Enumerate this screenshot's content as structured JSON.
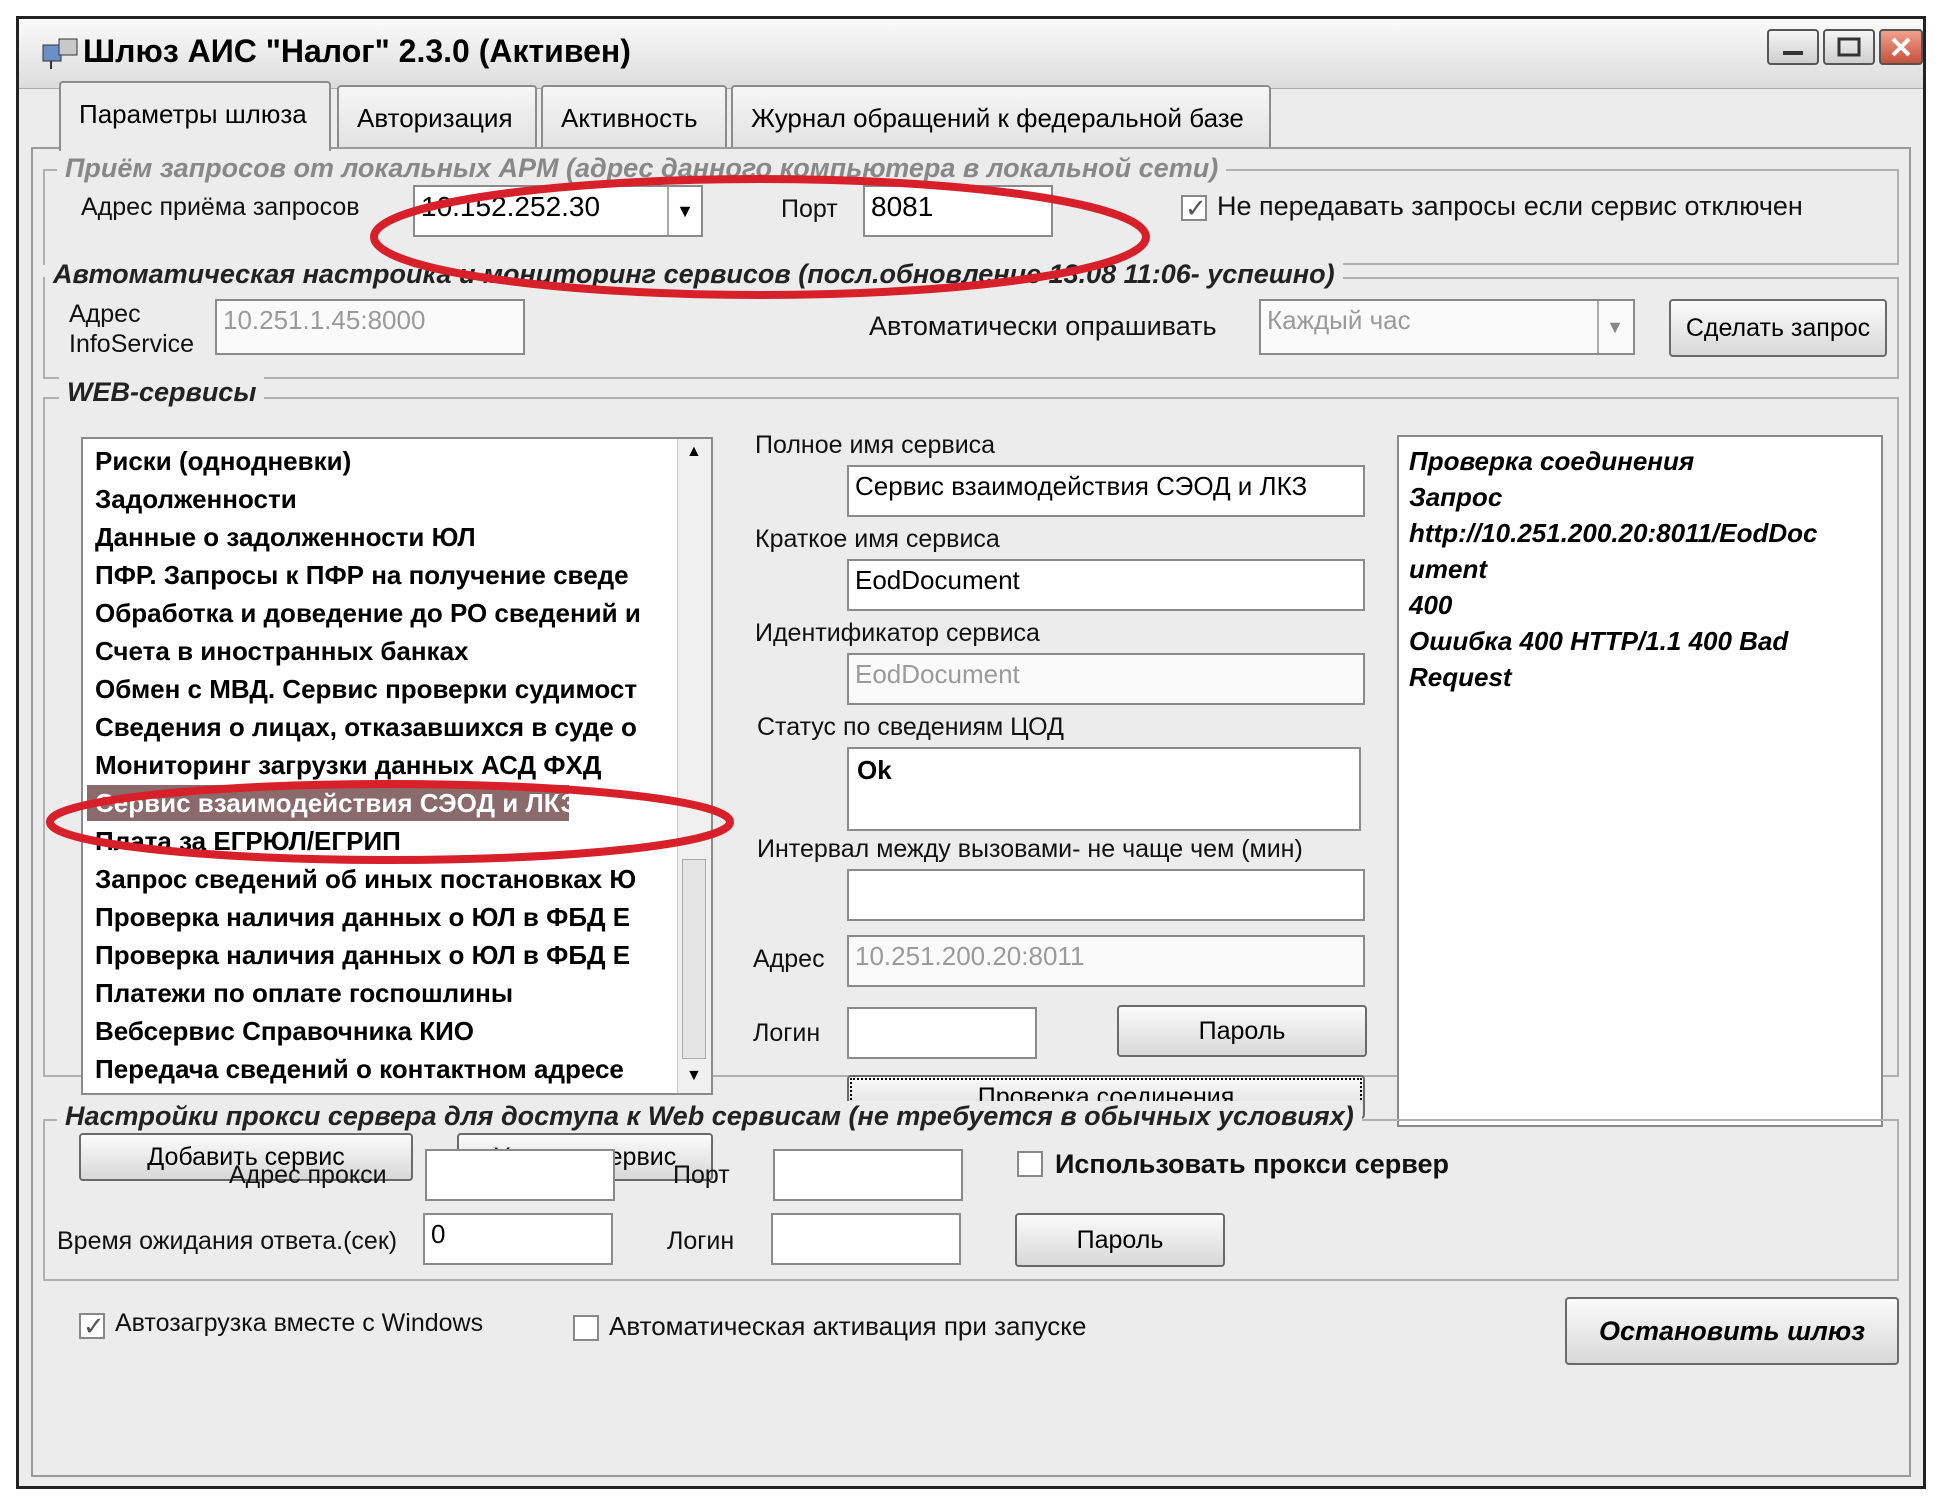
{
  "window": {
    "title": "Шлюз АИС \"Налог\" 2.3.0 (Активен)"
  },
  "tabs": [
    {
      "label": "Параметры шлюза",
      "active": true
    },
    {
      "label": "Авторизация",
      "active": false
    },
    {
      "label": "Активность",
      "active": false
    },
    {
      "label": "Журнал обращений к федеральной базе",
      "active": false
    }
  ],
  "local": {
    "group_title": "Приём запросов от локальных АРМ (адрес данного компьютера в локальной сети)",
    "address_label": "Адрес  приёма запросов",
    "address_value": "10.152.252.30",
    "port_label": "Порт",
    "port_value": "8081",
    "no_forward_label": "Не передавать запросы если сервис отключен",
    "no_forward_checked": true
  },
  "auto": {
    "group_title": "Автоматическая настройка и мониторинг сервисов (посл.обновление  13.08 11:06- успешно)",
    "infoservice_label_1": "Адрес",
    "infoservice_label_2": "InfoService",
    "infoservice_value": "10.251.1.45:8000",
    "poll_label": "Автоматически опрашивать",
    "poll_value": "Каждый час",
    "request_button": "Сделать запрос"
  },
  "web": {
    "group_title": "WEB-сервисы",
    "services": [
      "Риски (однодневки)",
      "Задолженности",
      "Данные о задолженности ЮЛ",
      "ПФР. Запросы к ПФР на получение сведе",
      "Обработка и доведение до РО сведений и",
      "Счета в иностранных банках",
      "Обмен с МВД. Сервис проверки судимост",
      "Сведения о лицах, отказавшихся в суде о",
      "Мониторинг загрузки данных АСД ФХД",
      "Сервис взаимодействия СЭОД и ЛКЗ",
      "Плата за ЕГРЮЛ/ЕГРИП",
      "Запрос сведений об иных постановках Ю",
      "Проверка наличия данных о ЮЛ в ФБД Е",
      "Проверка наличия данных о ЮЛ в ФБД Е",
      "Платежи по оплате госпошлины",
      "Вебсервис Справочника КИО",
      "Передача сведений о контактном адресе"
    ],
    "selected_index": 9,
    "add_button": "Добавить сервис",
    "delete_button": "Удалить сервис",
    "full_name_label": "Полное имя сервиса",
    "full_name_value": "Сервис взаимодействия СЭОД и ЛКЗ",
    "short_name_label": "Краткое имя сервиса",
    "short_name_value": "EodDocument",
    "id_label": "Идентификатор сервиса",
    "id_value": "EodDocument",
    "status_label": "Статус по сведениям ЦОД",
    "status_value": "Ok",
    "interval_label": "Интервал между вызовами- не чаще чем (мин)",
    "interval_value": "",
    "address_label": "Адрес",
    "address_value": "10.251.200.20:8011",
    "login_label": "Логин",
    "login_value": "",
    "password_button": "Пароль",
    "check_button": "Проверка соединения",
    "result_lines": [
      "Проверка соединения",
      "Запрос",
      "http://10.251.200.20:8011/EodDoc",
      "ument",
      "400",
      "Ошибка 400 HTTP/1.1 400 Bad",
      "Request"
    ]
  },
  "proxy": {
    "group_title": "Настройки прокси сервера для доступа к Web сервисам (не требуется в обычных условиях)",
    "address_label": "Адрес прокси",
    "address_value": "",
    "port_label": "Порт",
    "port_value": "",
    "use_proxy_label": "Использовать прокси сервер",
    "use_proxy_checked": false,
    "timeout_label": "Время ожидания ответа.(сек)",
    "timeout_value": "0",
    "login_label": "Логин",
    "login_value": "",
    "password_button": "Пароль"
  },
  "footer": {
    "autoload_label": "Автозагрузка вместе с Windows",
    "autoload_checked": true,
    "autoactivate_label": "Автоматическая активация при запуске",
    "autoactivate_checked": false,
    "stop_button": "Остановить шлюз"
  },
  "colors": {
    "annotation": "#d8202a",
    "selection": "#8a6a6a"
  }
}
